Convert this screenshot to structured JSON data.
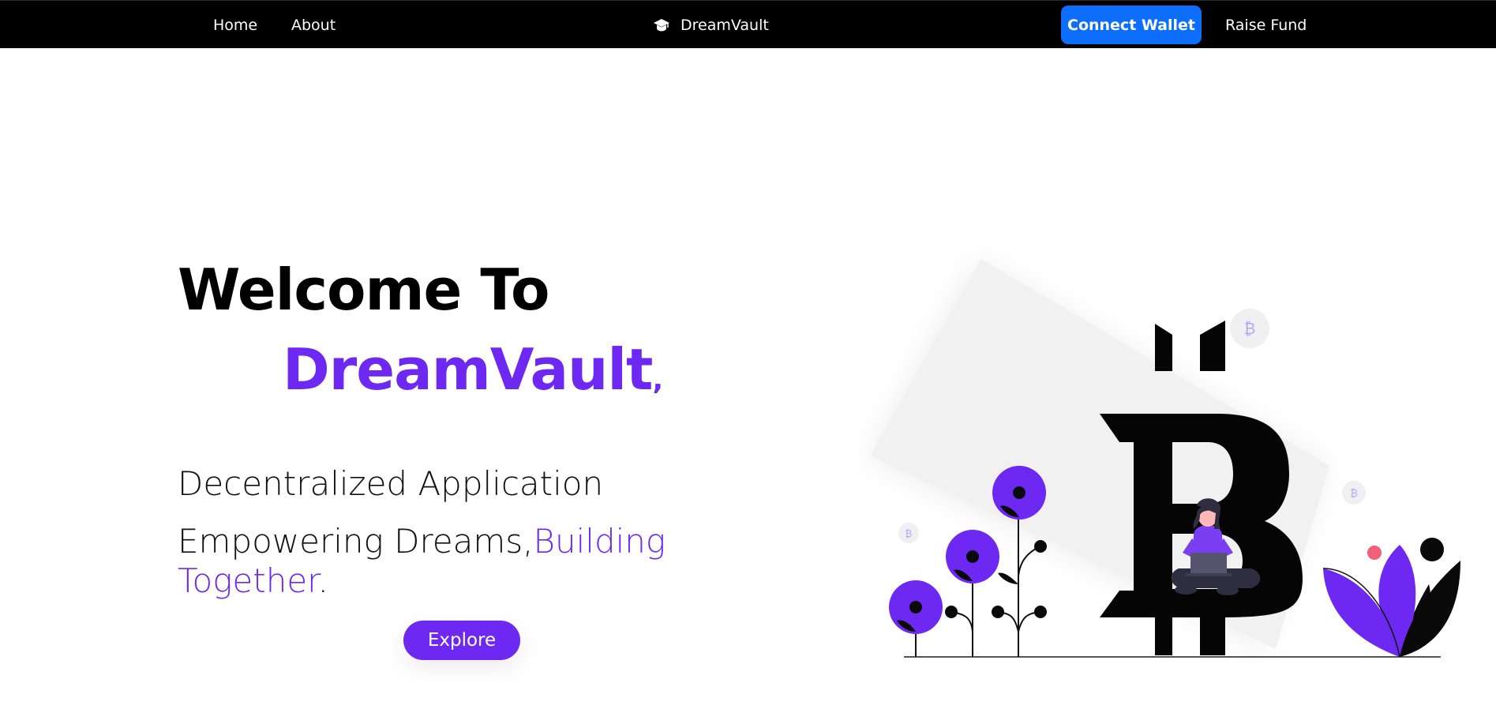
{
  "navbar": {
    "home_label": "Home",
    "about_label": "About",
    "brand_name": "DreamVault",
    "brand_icon": "graduation-cap-icon",
    "connect_wallet_label": "Connect Wallet",
    "raise_fund_label": "Raise Fund"
  },
  "hero": {
    "title": "Welcome To",
    "brand": "DreamVault",
    "brand_suffix": ",",
    "subtitle": "Decentralized Application",
    "tagline_part1": "Empowering Dreams,",
    "tagline_accent": "Building Together",
    "tagline_end": ".",
    "explore_label": "Explore"
  },
  "illustration": {
    "central_icon": "bitcoin-icon",
    "coin_icon": "bitcoin-coin-icon"
  },
  "colors": {
    "accent": "#6d28f2",
    "primary_button": "#0d6efd",
    "navbar_bg": "#000000",
    "pink_dot": "#f0607a"
  }
}
